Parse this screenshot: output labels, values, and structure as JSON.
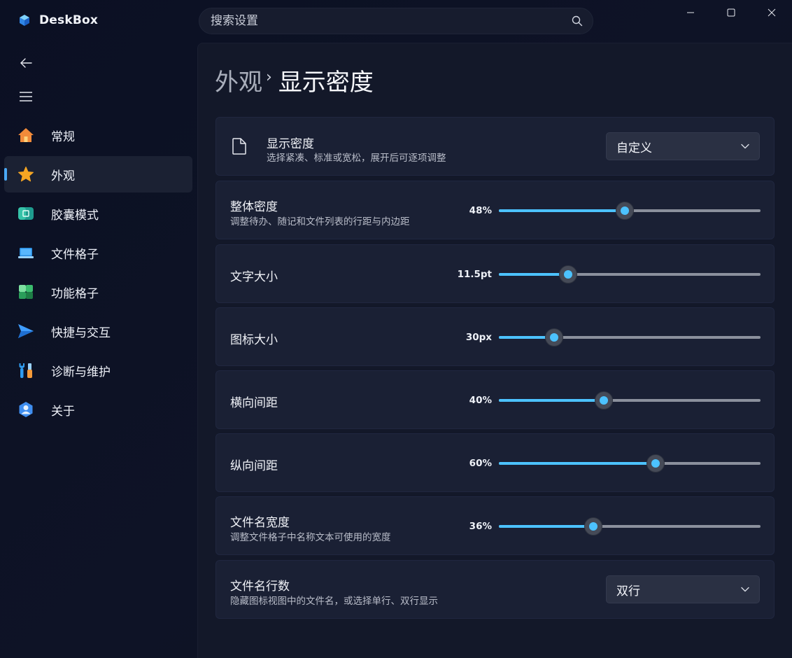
{
  "app": {
    "name": "DeskBox"
  },
  "search": {
    "placeholder": "搜索设置"
  },
  "sidebar": {
    "items": [
      {
        "label": "常规",
        "icon": "home-icon"
      },
      {
        "label": "外观",
        "icon": "star-icon",
        "active": true
      },
      {
        "label": "胶囊模式",
        "icon": "capsule-icon"
      },
      {
        "label": "文件格子",
        "icon": "laptop-icon"
      },
      {
        "label": "功能格子",
        "icon": "blocks-icon"
      },
      {
        "label": "快捷与交互",
        "icon": "send-icon"
      },
      {
        "label": "诊断与维护",
        "icon": "tools-icon"
      },
      {
        "label": "关于",
        "icon": "about-icon"
      }
    ]
  },
  "breadcrumb": {
    "parent": "外观",
    "separator": "›",
    "current": "显示密度"
  },
  "settings": {
    "density": {
      "title": "显示密度",
      "desc": "选择紧凑、标准或宽松，展开后可逐项调整",
      "value": "自定义"
    },
    "overall": {
      "title": "整体密度",
      "desc": "调整待办、随记和文件列表的行距与内边距",
      "value_text": "48%",
      "fraction": 0.48
    },
    "font_size": {
      "title": "文字大小",
      "value_text": "11.5pt",
      "fraction": 0.265
    },
    "icon_size": {
      "title": "图标大小",
      "value_text": "30px",
      "fraction": 0.21
    },
    "h_spacing": {
      "title": "横向间距",
      "value_text": "40%",
      "fraction": 0.4
    },
    "v_spacing": {
      "title": "纵向间距",
      "value_text": "60%",
      "fraction": 0.6
    },
    "name_width": {
      "title": "文件名宽度",
      "desc": "调整文件格子中名称文本可使用的宽度",
      "value_text": "36%",
      "fraction": 0.36
    },
    "name_lines": {
      "title": "文件名行数",
      "desc": "隐藏图标视图中的文件名，或选择单行、双行显示",
      "value": "双行"
    }
  },
  "colors": {
    "accent": "#4cc2ff",
    "background": "#131829",
    "card": "#1a2034"
  }
}
